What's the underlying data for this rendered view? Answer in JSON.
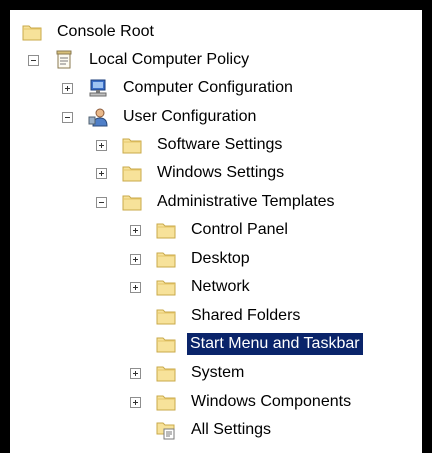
{
  "tree": {
    "console_root": "Console Root",
    "local_computer_policy": "Local Computer Policy",
    "computer_configuration": "Computer Configuration",
    "user_configuration": "User Configuration",
    "software_settings": "Software Settings",
    "windows_settings": "Windows Settings",
    "administrative_templates": "Administrative Templates",
    "control_panel": "Control Panel",
    "desktop": "Desktop",
    "network": "Network",
    "shared_folders": "Shared Folders",
    "start_menu_and_taskbar": "Start Menu and Taskbar",
    "system": "System",
    "windows_components": "Windows Components",
    "all_settings": "All Settings",
    "selected_item": "Start Menu and Taskbar"
  },
  "icons": {
    "folder": "folder-icon",
    "policy": "policy-document-icon",
    "computer": "computer-icon",
    "user": "user-icon",
    "settings": "all-settings-icon"
  },
  "colors": {
    "selection": "#0a246a",
    "folder_fill": "#f7e29a",
    "folder_stroke": "#c9a94a"
  }
}
